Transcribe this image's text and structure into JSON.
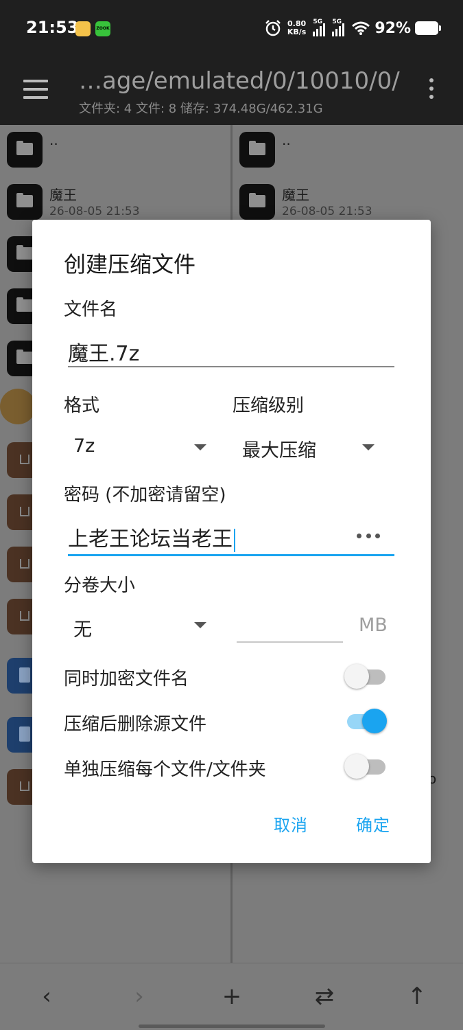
{
  "status_bar": {
    "time": "21:53",
    "notif_label": "ZOOK",
    "net_speed_value": "0.80",
    "net_speed_unit": "KB/s",
    "sim1": "5G",
    "sim2": "5G",
    "battery": "92%"
  },
  "toolbar": {
    "path": "…age/emulated/0/10010/0/",
    "summary": "文件夹: 4  文件: 8  储存: 374.48G/462.31G"
  },
  "left_pane": {
    "rows": [
      {
        "name": "..",
        "date": ""
      },
      {
        "name": "魔王",
        "date": "26-08-05 21:53"
      }
    ]
  },
  "right_pane": {
    "rows": [
      {
        "name": "..",
        "date": ""
      },
      {
        "name": "魔王",
        "date": "26-08-05 21:53"
      }
    ],
    "stray_char": "o"
  },
  "dialog": {
    "title": "创建压缩文件",
    "filename_label": "文件名",
    "filename_value": "魔王.7z",
    "format_label": "格式",
    "format_value": "7z",
    "level_label": "压缩级别",
    "level_value": "最大压缩",
    "password_label": "密码 (不加密请留空)",
    "password_value": "上老王论坛当老王",
    "volume_label": "分卷大小",
    "volume_value": "无",
    "volume_size_value": "",
    "volume_unit": "MB",
    "toggles": [
      {
        "label": "同时加密文件名",
        "on": false
      },
      {
        "label": "压缩后删除源文件",
        "on": true
      },
      {
        "label": "单独压缩每个文件/文件夹",
        "on": false
      }
    ],
    "cancel_label": "取消",
    "ok_label": "确定"
  },
  "bottom_bar": {
    "back": "‹",
    "forward": "›",
    "add": "+",
    "swap": "⇄",
    "up": "↑"
  },
  "colors": {
    "accent": "#1aa4f0",
    "dim_background": "#7c7c7c",
    "bar_background": "#1f1f1f"
  }
}
